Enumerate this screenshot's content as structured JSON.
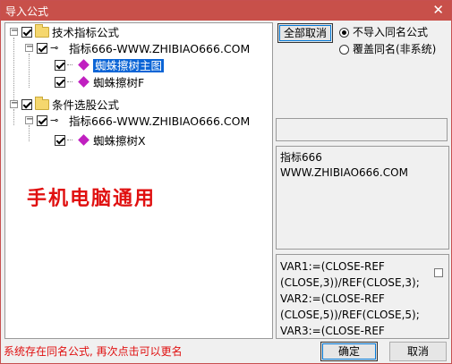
{
  "window": {
    "title": "导入公式",
    "close_glyph": "✕"
  },
  "tree": {
    "groups": [
      {
        "label": "技术指标公式",
        "formula": {
          "label": "指标666-WWW.ZHIBIAO666.COM",
          "items": [
            "蜘蛛擦树主图",
            "蜘蛛擦树F"
          ]
        }
      },
      {
        "label": "条件选股公式",
        "formula": {
          "label": "指标666-WWW.ZHIBIAO666.COM",
          "items": [
            "蜘蛛擦树X"
          ]
        }
      }
    ]
  },
  "banner": "手机电脑通用",
  "controls": {
    "deselect_all": "全部取消",
    "radio_skip": "不导入同名公式",
    "radio_overwrite": "覆盖同名(非系统)"
  },
  "description": {
    "line1": "指标666",
    "line2": "WWW.ZHIBIAO666.COM"
  },
  "code": {
    "text": "VAR1:=(CLOSE-REF\n(CLOSE,3))/REF(CLOSE,3);\nVAR2:=(CLOSE-REF\n(CLOSE,5))/REF(CLOSE,5);\nVAR3:=(CLOSE-REF"
  },
  "status": "系统存在同名公式, 再次点击可以更名",
  "buttons": {
    "ok": "确定",
    "cancel": "取消"
  },
  "colors": {
    "titlebar": "#c8504a",
    "accent_red": "#e01010",
    "selection": "#0a64d6"
  }
}
